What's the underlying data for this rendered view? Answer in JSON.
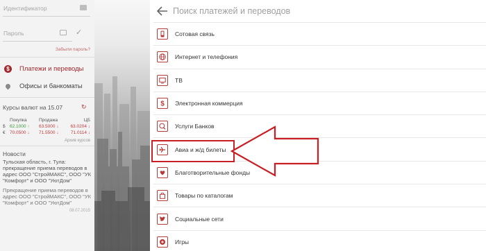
{
  "sidebar": {
    "login_placeholder": "Идентификатор",
    "password_placeholder": "Пароль",
    "forgot_password": "Забыли пароль?",
    "nav": [
      {
        "label": "Платежи и переводы",
        "icon": "dollar-icon",
        "active": true
      },
      {
        "label": "Офисы и банкоматы",
        "icon": "map-pin-icon",
        "active": false
      }
    ],
    "rates": {
      "title": "Курсы валют на 15.07",
      "headers": {
        "buy": "Покупка",
        "sell": "Продажа",
        "cb": "ЦБ"
      },
      "rows": [
        {
          "currency": "$",
          "buy": "62.1000",
          "buy_trend": "up",
          "sell": "63.5000",
          "sell_trend": "down",
          "cb": "63.0204",
          "cb_trend": "down"
        },
        {
          "currency": "€",
          "buy": "70.0500",
          "buy_trend": "down",
          "sell": "71.5500",
          "sell_trend": "down",
          "cb": "71.0114",
          "cb_trend": "down"
        }
      ],
      "archive": "Архив курсов"
    },
    "news": {
      "title": "Новости",
      "items": [
        "Тульская область, г. Тула: прекращение приема переводов в адрес ООО \"СтройМАКС\", ООО \"УК \"Комфорт\" и ООО \"УютДом\"",
        "Прекращение приема переводов в адрес ООО \"СтройМАКС\", ООО \"УК \"Комфорт\" и ООО \"УютДом\""
      ],
      "date": "08.07.2015"
    }
  },
  "main": {
    "search_placeholder": "Поиск платежей и переводов",
    "categories": [
      {
        "label": "Сотовая связь",
        "icon": "mobile-phone-icon"
      },
      {
        "label": "Интернет и телефония",
        "icon": "globe-icon"
      },
      {
        "label": "ТВ",
        "icon": "tv-icon"
      },
      {
        "label": "Электронная коммерция",
        "icon": "dollar-icon"
      },
      {
        "label": "Услуги Банков",
        "icon": "bank-icon"
      },
      {
        "label": "Авиа и ж/д билеты",
        "icon": "airplane-icon"
      },
      {
        "label": "Благотворительные фонды",
        "icon": "heart-hands-icon"
      },
      {
        "label": "Товары по каталогам",
        "icon": "shopping-bag-icon"
      },
      {
        "label": "Социальные сети",
        "icon": "twitter-bird-icon"
      },
      {
        "label": "Игры",
        "icon": "gamepad-icon"
      }
    ],
    "highlighted_category": "Авиа и ж/д билеты"
  },
  "colors": {
    "accent": "#a3282c",
    "annotation_red": "#c81e24",
    "sidebar_bg": "#f3f3f3",
    "up": "#3a9a3a",
    "down": "#c23b3b"
  }
}
